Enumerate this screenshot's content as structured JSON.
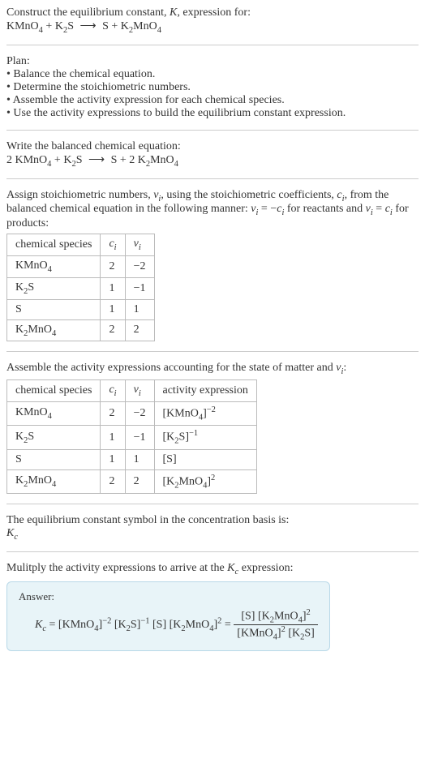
{
  "intro": {
    "line1": "Construct the equilibrium constant, ",
    "K": "K",
    "line1b": ", expression for:",
    "eq_lhs1": "KMnO",
    "eq_lhs1_sub": "4",
    "plus": " + ",
    "eq_lhs2": "K",
    "eq_lhs2_sub": "2",
    "eq_lhs2b": "S",
    "arrow": "⟶",
    "eq_rhs1": "S + K",
    "eq_rhs1_sub": "2",
    "eq_rhs1b": "MnO",
    "eq_rhs1_sub2": "4"
  },
  "plan": {
    "title": "Plan:",
    "b1": "• Balance the chemical equation.",
    "b2": "• Determine the stoichiometric numbers.",
    "b3": "• Assemble the activity expression for each chemical species.",
    "b4": "• Use the activity expressions to build the equilibrium constant expression."
  },
  "balanced": {
    "title": "Write the balanced chemical equation:",
    "c1": "2 KMnO",
    "c1_sub": "4",
    "plus": " + K",
    "c2_sub": "2",
    "c2b": "S",
    "arrow": "⟶",
    "rhs": "S + 2 K",
    "rhs_sub": "2",
    "rhs_b": "MnO",
    "rhs_sub2": "4"
  },
  "assign": {
    "text1": "Assign stoichiometric numbers, ",
    "nu": "ν",
    "i": "i",
    "text2": ", using the stoichiometric coefficients, ",
    "c": "c",
    "text3": ", from the balanced chemical equation in the following manner: ",
    "eq1a": "ν",
    "eq1b": " = −",
    "eq1c": "c",
    "text4": " for reactants and ",
    "eq2a": "ν",
    "eq2b": " = ",
    "eq2c": "c",
    "text5": " for products:"
  },
  "table1": {
    "h1": "chemical species",
    "h2": "c",
    "h2_sub": "i",
    "h3": "ν",
    "h3_sub": "i",
    "r1": {
      "s1": "KMnO",
      "s1_sub": "4",
      "c": "2",
      "n": "−2"
    },
    "r2": {
      "s1": "K",
      "s1_sub": "2",
      "s1b": "S",
      "c": "1",
      "n": "−1"
    },
    "r3": {
      "s1": "S",
      "c": "1",
      "n": "1"
    },
    "r4": {
      "s1": "K",
      "s1_sub": "2",
      "s1b": "MnO",
      "s1_sub2": "4",
      "c": "2",
      "n": "2"
    }
  },
  "assemble": {
    "text1": "Assemble the activity expressions accounting for the state of matter and ",
    "nu": "ν",
    "i": "i",
    "text2": ":"
  },
  "table2": {
    "h1": "chemical species",
    "h2": "c",
    "h2_sub": "i",
    "h3": "ν",
    "h3_sub": "i",
    "h4": "activity expression",
    "r1": {
      "s1": "KMnO",
      "s1_sub": "4",
      "c": "2",
      "n": "−2",
      "a1": "[KMnO",
      "a1_sub": "4",
      "a1b": "]",
      "a1_sup": "−2"
    },
    "r2": {
      "s1": "K",
      "s1_sub": "2",
      "s1b": "S",
      "c": "1",
      "n": "−1",
      "a1": "[K",
      "a1_sub": "2",
      "a1b": "S]",
      "a1_sup": "−1"
    },
    "r3": {
      "s1": "S",
      "c": "1",
      "n": "1",
      "a1": "[S]"
    },
    "r4": {
      "s1": "K",
      "s1_sub": "2",
      "s1b": "MnO",
      "s1_sub2": "4",
      "c": "2",
      "n": "2",
      "a1": "[K",
      "a1_sub": "2",
      "a1b": "MnO",
      "a1_sub2": "4",
      "a1c": "]",
      "a1_sup": "2"
    }
  },
  "symbol": {
    "text": "The equilibrium constant symbol in the concentration basis is:",
    "K": "K",
    "c": "c"
  },
  "multiply": {
    "text1": "Mulitply the activity expressions to arrive at the ",
    "K": "K",
    "c": "c",
    "text2": " expression:"
  },
  "answer": {
    "label": "Answer:",
    "K": "K",
    "c": "c",
    "eq": " = ",
    "t1": "[KMnO",
    "t1_sub": "4",
    "t1b": "]",
    "t1_sup": "−2",
    "t2": " [K",
    "t2_sub": "2",
    "t2b": "S]",
    "t2_sup": "−1",
    "t3": " [S] [K",
    "t3_sub": "2",
    "t3b": "MnO",
    "t3_sub2": "4",
    "t3c": "]",
    "t3_sup": "2",
    "eq2": " = ",
    "num1": "[S] [K",
    "num1_sub": "2",
    "num1b": "MnO",
    "num1_sub2": "4",
    "num1c": "]",
    "num1_sup": "2",
    "den1": "[KMnO",
    "den1_sub": "4",
    "den1b": "]",
    "den1_sup": "2",
    "den2": " [K",
    "den2_sub": "2",
    "den2b": "S]"
  }
}
